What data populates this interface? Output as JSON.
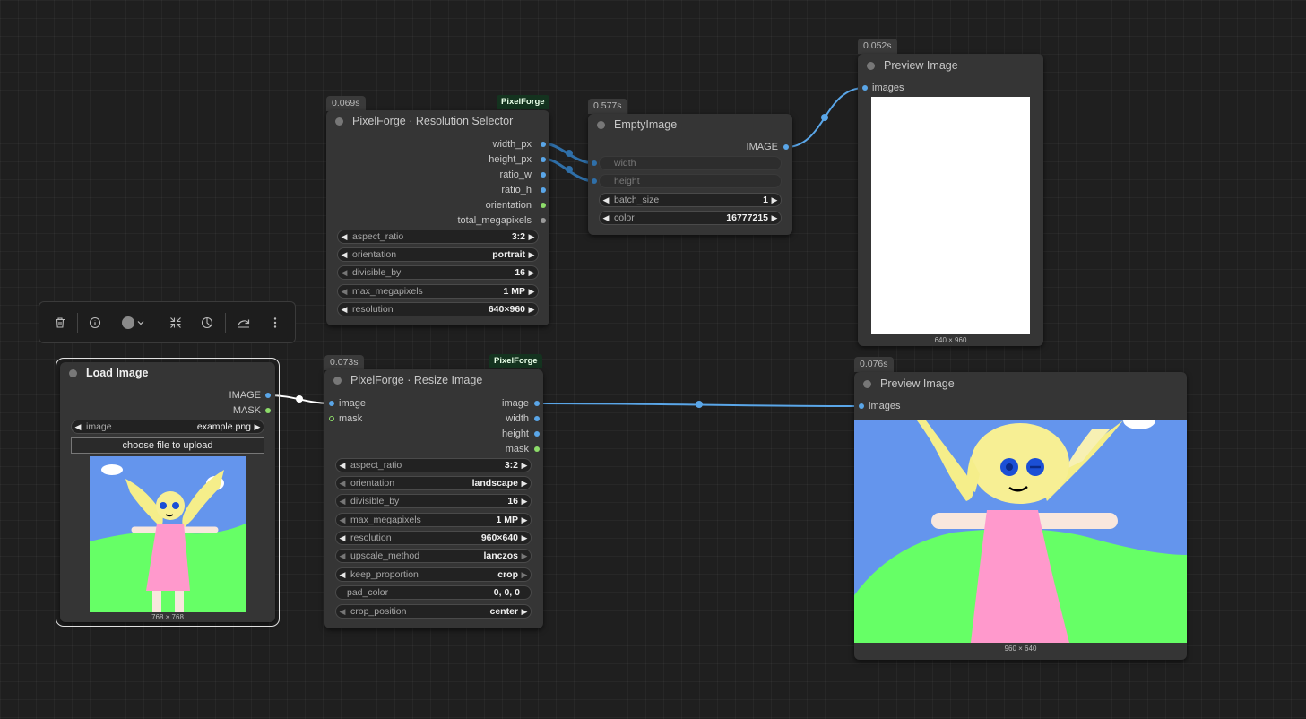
{
  "nodes": {
    "resolution_selector": {
      "timing": "0.069s",
      "badge": "PixelForge",
      "title": "PixelForge · Resolution Selector",
      "outputs": [
        "width_px",
        "height_px",
        "ratio_w",
        "ratio_h",
        "orientation",
        "total_megapixels"
      ],
      "widgets": [
        {
          "name": "aspect_ratio",
          "value": "3:2"
        },
        {
          "name": "orientation",
          "value": "portrait"
        },
        {
          "name": "divisible_by",
          "value": "16"
        },
        {
          "name": "max_megapixels",
          "value": "1 MP"
        },
        {
          "name": "resolution",
          "value": "640×960"
        }
      ]
    },
    "empty_image": {
      "timing": "0.577s",
      "title": "EmptyImage",
      "output": "IMAGE",
      "inputs": [
        "width",
        "height"
      ],
      "widgets": [
        {
          "name": "batch_size",
          "value": "1"
        },
        {
          "name": "color",
          "value": "16777215"
        }
      ]
    },
    "preview_top": {
      "timing": "0.052s",
      "title": "Preview Image",
      "input": "images",
      "caption": "640 × 960"
    },
    "load_image": {
      "title": "Load Image",
      "outputs": [
        "IMAGE",
        "MASK"
      ],
      "widget": {
        "name": "image",
        "value": "example.png"
      },
      "upload_label": "choose file to upload",
      "caption": "768 × 768"
    },
    "resize_image": {
      "timing": "0.073s",
      "badge": "PixelForge",
      "title": "PixelForge · Resize Image",
      "inputs": [
        "image",
        "mask"
      ],
      "outputs": [
        "image",
        "width",
        "height",
        "mask"
      ],
      "widgets": [
        {
          "name": "aspect_ratio",
          "value": "3:2"
        },
        {
          "name": "orientation",
          "value": "landscape"
        },
        {
          "name": "divisible_by",
          "value": "16"
        },
        {
          "name": "max_megapixels",
          "value": "1 MP"
        },
        {
          "name": "resolution",
          "value": "960×640"
        },
        {
          "name": "upscale_method",
          "value": "lanczos"
        },
        {
          "name": "keep_proportion",
          "value": "crop"
        },
        {
          "name": "pad_color",
          "value": "0, 0, 0"
        },
        {
          "name": "crop_position",
          "value": "center"
        }
      ]
    },
    "preview_bottom": {
      "timing": "0.076s",
      "title": "Preview Image",
      "input": "images",
      "caption": "960 × 640"
    }
  },
  "toolbar": {
    "icons": [
      "trash-icon",
      "info-icon",
      "color-circle-icon",
      "chevron-down-icon",
      "collapse-icon",
      "palette-icon",
      "bypass-icon",
      "more-icon"
    ]
  },
  "colors": {
    "link_image": "#5aa6e8",
    "link_int": "#2f6fa8",
    "badge_bg": "#14331f",
    "canvas": "#1f1f1f",
    "node_bg": "#353535",
    "sky": "#6495ed",
    "grass": "#66ff66",
    "dress": "#ff99cc",
    "hair": "#f5ee8a"
  }
}
